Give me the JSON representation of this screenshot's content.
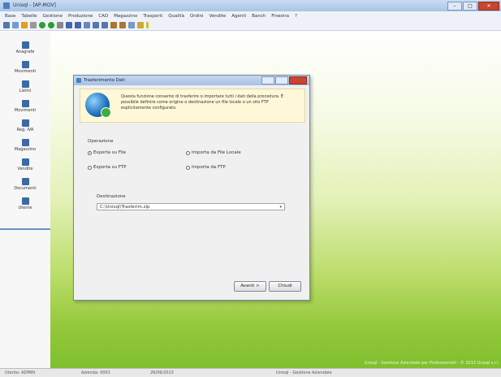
{
  "window": {
    "title": "Unisql - [AP-MOV]",
    "app_icon": "app-logo-icon"
  },
  "menu": [
    "Base",
    "Tabelle",
    "Gestione",
    "Produzione",
    "CAD",
    "Magazzino",
    "Trasporti",
    "Qualità",
    "Ordini",
    "Vendite",
    "Agenti",
    "Banch",
    "Finestra",
    "?"
  ],
  "sidebar": {
    "items": [
      {
        "label": "Anagrafe",
        "icon": "people-icon"
      },
      {
        "label": "Movimenti",
        "icon": "movements-icon"
      },
      {
        "label": "Listini",
        "icon": "price-list-icon"
      },
      {
        "label": "Movimenti",
        "icon": "movements-icon"
      },
      {
        "label": "Reg. IVA",
        "icon": "register-icon"
      },
      {
        "label": "Magazzino",
        "icon": "warehouse-icon"
      },
      {
        "label": "Vendite",
        "icon": "sales-icon"
      },
      {
        "label": "Documenti",
        "icon": "documents-icon"
      },
      {
        "label": "Utente",
        "icon": "user-icon"
      }
    ]
  },
  "dialog": {
    "title": "Trasferimento Dati",
    "info_text": "Questa funzione consente di trasferire o importare tutti i dati della procedura. È possibile definire come origine o destinazione un file locale o un sito FTP esplicitamente configurato.",
    "section_label": "Operazione",
    "options": [
      {
        "label": "Esporta su File",
        "selected": true
      },
      {
        "label": "Importa da File Locale",
        "selected": false
      },
      {
        "label": "Esporta su FTP",
        "selected": false
      },
      {
        "label": "Importa da FTP",
        "selected": false
      }
    ],
    "destination_label": "Destinazione",
    "destination_value": "C:\\Unisql\\Trasferim.zip",
    "next_button": "Avanti >",
    "close_button": "Chiudi"
  },
  "footer_text": "Unisql - Gestione Aziendale per Professionisti - © 2013 Unisql s.r.l.",
  "status": {
    "user": "Utente: ADMIN",
    "db": "Azienda: 0001",
    "date": "26/06/2013",
    "right": "Unisql - Gestione Aziendale"
  },
  "colors": {
    "accent": "#3b6aa5",
    "background_green": "#7fbf2d",
    "dialog_close": "#c8452f"
  }
}
